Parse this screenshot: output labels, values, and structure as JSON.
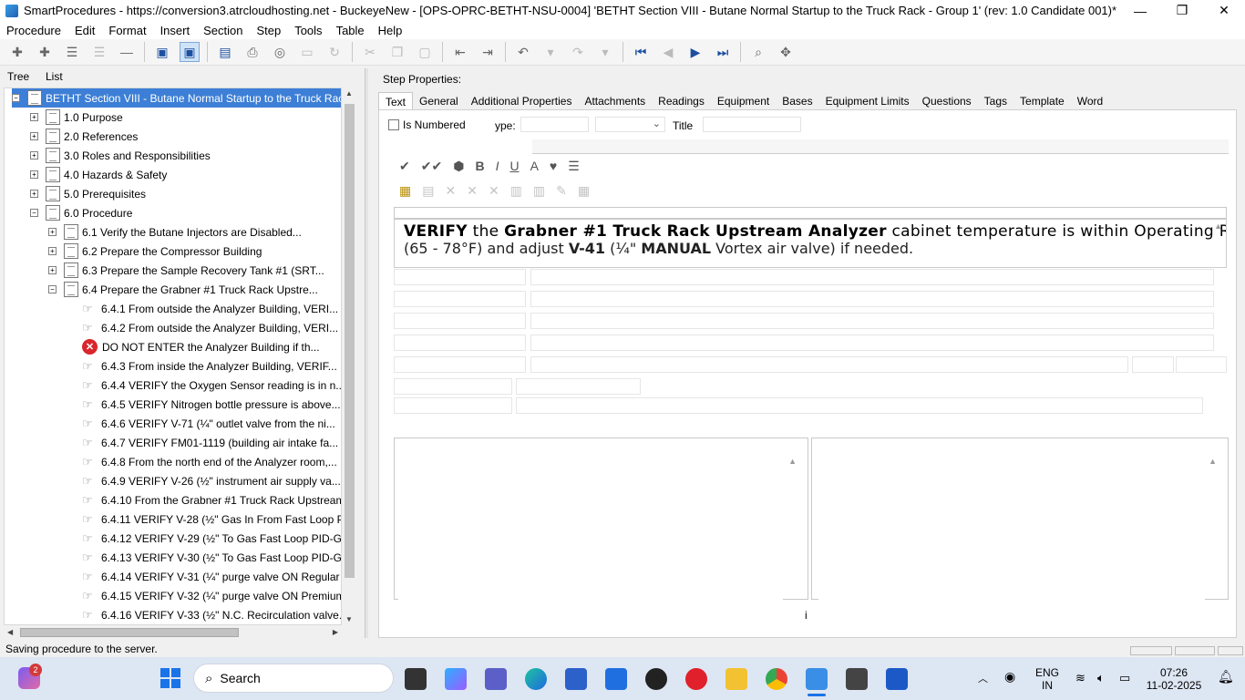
{
  "window": {
    "title": "SmartProcedures - https://conversion3.atrcloudhosting.net - BuckeyeNew - [OPS-OPRC-BETHT-NSU-0004] 'BETHT Section VIII - Butane Normal Startup to the Truck Rack - Group 1' (rev: 1.0 Candidate 001)*",
    "minimize": "—",
    "maximize": "❐",
    "close": "✕"
  },
  "menu": [
    "Procedure",
    "Edit",
    "Format",
    "Insert",
    "Section",
    "Step",
    "Tools",
    "Table",
    "Help"
  ],
  "left": {
    "tabs": [
      "Tree",
      "List"
    ],
    "tree": [
      {
        "label": "BETHT Section VIII - Butane Normal Startup to the Truck Rack...",
        "kind": "doc",
        "exp": "−",
        "level": 0,
        "selected": true
      },
      {
        "label": "1.0 Purpose",
        "kind": "doc",
        "exp": "+",
        "level": 1
      },
      {
        "label": "2.0 References",
        "kind": "doc",
        "exp": "+",
        "level": 1
      },
      {
        "label": "3.0 Roles and Responsibilities",
        "kind": "doc",
        "exp": "+",
        "level": 1
      },
      {
        "label": "4.0 Hazards & Safety",
        "kind": "doc",
        "exp": "+",
        "level": 1
      },
      {
        "label": "5.0 Prerequisites",
        "kind": "doc",
        "exp": "+",
        "level": 1
      },
      {
        "label": "6.0 Procedure",
        "kind": "doc",
        "exp": "−",
        "level": 1
      },
      {
        "label": "6.1 Verify the Butane Injectors are Disabled...",
        "kind": "doc",
        "exp": "+",
        "level": 2
      },
      {
        "label": "6.2 Prepare the Compressor Building",
        "kind": "doc",
        "exp": "+",
        "level": 2
      },
      {
        "label": "6.3 Prepare the Sample Recovery Tank #1 (SRT...",
        "kind": "doc",
        "exp": "+",
        "level": 2
      },
      {
        "label": "6.4 Prepare the Grabner #1 Truck Rack Upstre...",
        "kind": "doc",
        "exp": "−",
        "level": 2
      },
      {
        "label": "6.4.1 From outside the Analyzer Building, VERI...",
        "kind": "step",
        "level": 3
      },
      {
        "label": "6.4.2 From outside the Analyzer Building, VERI...",
        "kind": "step",
        "level": 3
      },
      {
        "label": "DO NOT ENTER the Analyzer Building if th...",
        "kind": "error",
        "level": 3
      },
      {
        "label": "6.4.3 From inside the Analyzer Building, VERIF...",
        "kind": "step",
        "level": 3
      },
      {
        "label": "6.4.4 VERIFY the Oxygen Sensor reading is in n...",
        "kind": "step",
        "level": 3
      },
      {
        "label": "6.4.5 VERIFY Nitrogen bottle pressure is above...",
        "kind": "step",
        "level": 3
      },
      {
        "label": "6.4.6 VERIFY V-71 (¼\" outlet valve from the ni...",
        "kind": "step",
        "level": 3
      },
      {
        "label": "6.4.7 VERIFY FM01-1119 (building air intake fa...",
        "kind": "step",
        "level": 3
      },
      {
        "label": "6.4.8 From the north end of the Analyzer room,...",
        "kind": "step",
        "level": 3
      },
      {
        "label": "6.4.9 VERIFY V-26 (½\" instrument air supply va...",
        "kind": "step",
        "level": 3
      },
      {
        "label": "6.4.10 From the Grabner #1 Truck Rack Upstream...",
        "kind": "step",
        "level": 3
      },
      {
        "label": "6.4.11 VERIFY V-28 (½\" Gas In From Fast Loop PI...",
        "kind": "step",
        "level": 3
      },
      {
        "label": "6.4.12 VERIFY V-29 (½\" To Gas Fast Loop PID-GF...",
        "kind": "step",
        "level": 3
      },
      {
        "label": "6.4.13 VERIFY V-30 (½\" To Gas Fast Loop PID-GF...",
        "kind": "step",
        "level": 3
      },
      {
        "label": "6.4.14 VERIFY V-31 (¼\" purge valve ON Regular I...",
        "kind": "step",
        "level": 3
      },
      {
        "label": "6.4.15 VERIFY V-32 (¼\" purge valve ON Premium...",
        "kind": "step",
        "level": 3
      },
      {
        "label": "6.4.16 VERIFY V-33 (½\" N.C. Recirculation valve...",
        "kind": "step",
        "level": 3
      }
    ]
  },
  "right": {
    "heading": "Step Properties:",
    "tabs": [
      "Text",
      "General",
      "Additional Properties",
      "Attachments",
      "Readings",
      "Equipment",
      "Bases",
      "Equipment Limits",
      "Questions",
      "Tags",
      "Template",
      "Word"
    ],
    "active_tab": "Text",
    "is_numbered_label": "Is Numbered",
    "type_label": "ype:",
    "title_label": "Title",
    "step_text_line1": {
      "pre": "VERIFY",
      "mid1": " the ",
      "bold2": "Grabner #1 Truck Rack Upstream Analyzer",
      "rest": " cabinet temperature is within Operating Range"
    },
    "step_text_line2": {
      "a": "(65 - 78°F) and adjust ",
      "bold": "V-41",
      "b": " (¼\" ",
      "bold2": "MANUAL",
      "c": " Vortex air valve) if needed."
    },
    "fragment": "i"
  },
  "status": "Saving procedure to the server.",
  "taskbar": {
    "search": "Search",
    "lang1": "ENG",
    "lang2": "IN",
    "time": "07:26",
    "date": "11-02-2025",
    "badge": "2"
  }
}
